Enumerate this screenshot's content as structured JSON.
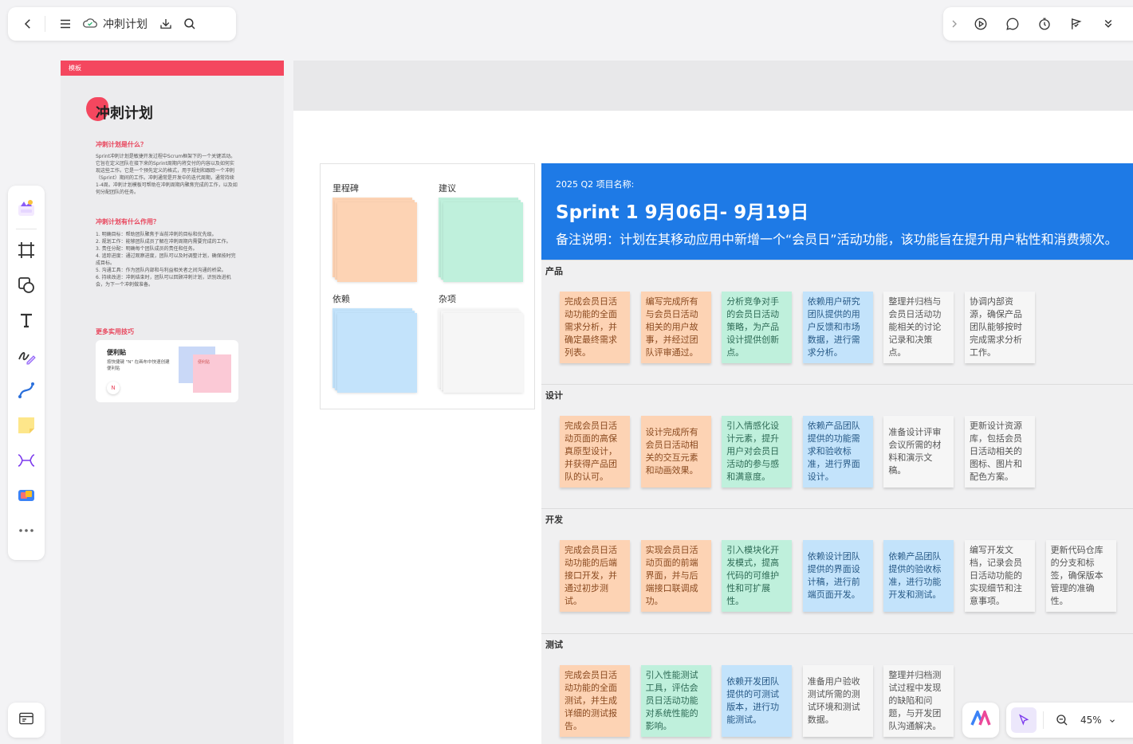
{
  "toolbar": {
    "doc_title": "冲刺计划"
  },
  "template": {
    "badge": "模板",
    "title": "冲刺计划",
    "h1": "冲刺计划是什么？",
    "p1": "Sprint冲刺计划是敏捷开发过程中Scrum框架下的一个关键活动。它旨在定义团队在接下来的Sprint周期内将交付的内容以及如何实现这些工作。它是一个预先定义的格式，用于规划和跟踪一个冲刺（Sprint）期间的工作。冲刺通常是开发中的迭代周期，通常持续1-4周。冲刺计划模板可帮助在冲刺周期内聚焦完成的工作，以及如何分配团队的任务。",
    "h2": "冲刺计划有什么作用？",
    "list": [
      "1. 明确目标：帮助团队聚焦于当前冲刺的目标和优先级。",
      "2. 规划工作：能够团队成员了解在冲刺周期内需要完成的工作。",
      "3. 责任分配：明确每个团队成员的责任和任务。",
      "4. 追踪进度：通过观察进度，团队可以及时调整计划，确保按时完成目标。",
      "5. 沟通工具：作为团队内部和与利益相关者之间沟通的桥梁。",
      "6. 持续改进：冲刺结束时，团队可以回顾冲刺计划，识别改进机会，为下一个冲刺做准备。"
    ],
    "h3": "更多实用技巧",
    "card_title": "便利贴",
    "card_desc": "按快捷键 \"N\" 在画布中快速创建便利贴",
    "card_key": "N",
    "card_sticky": "便利贴"
  },
  "legend": {
    "milestone": "里程碑",
    "suggestion": "建议",
    "dependency": "依赖",
    "misc": "杂项"
  },
  "sprint": {
    "project_label": "2025 Q2 项目名称:",
    "title": "Sprint 1   9月06日- 9月19日",
    "note": "备注说明：计划在其移动应用中新增一个“会员日”活动功能，该功能旨在提升用户粘性和消费频次。"
  },
  "lanes": [
    {
      "name": "产品",
      "notes": [
        {
          "text": "完成会员日活动功能的全面需求分析，并确定最终需求列表。",
          "color": "orange"
        },
        {
          "text": "编写完成所有与会员日活动相关的用户故事，并经过团队评审通过。",
          "color": "orange"
        },
        {
          "text": "分析竞争对手的会员日活动策略，为产品设计提供创新点。",
          "color": "green"
        },
        {
          "text": "依赖用户研究团队提供的用户反馈和市场数据，进行需求分析。",
          "color": "blue"
        },
        {
          "text": "整理并归档与会员日活动功能相关的讨论记录和决策点。",
          "color": "white"
        },
        {
          "text": "协调内部资源，确保产品团队能够按时完成需求分析工作。",
          "color": "white"
        }
      ]
    },
    {
      "name": "设计",
      "notes": [
        {
          "text": "完成会员日活动页面的高保真原型设计，并获得产品团队的认可。",
          "color": "orange"
        },
        {
          "text": "设计完成所有会员日活动相关的交互元素和动画效果。",
          "color": "orange"
        },
        {
          "text": "引入情感化设计元素，提升用户对会员日活动的参与感和满意度。",
          "color": "green"
        },
        {
          "text": "依赖产品团队提供的功能需求和验收标准，进行界面设计。",
          "color": "blue"
        },
        {
          "text": "准备设计评审会议所需的材料和演示文稿。",
          "color": "white"
        },
        {
          "text": "更新设计资源库，包括会员日活动相关的图标、图片和配色方案。",
          "color": "white"
        }
      ]
    },
    {
      "name": "开发",
      "notes": [
        {
          "text": "完成会员日活动功能的后端接口开发，并通过初步测试。",
          "color": "orange"
        },
        {
          "text": "实现会员日活动页面的前端界面，并与后端接口联调成功。",
          "color": "orange"
        },
        {
          "text": "引入模块化开发模式，提高代码的可维护性和可扩展性。",
          "color": "green"
        },
        {
          "text": "依赖设计团队提供的界面设计稿，进行前端页面开发。",
          "color": "blue"
        },
        {
          "text": "依赖产品团队提供的验收标准，进行功能开发和测试。",
          "color": "blue"
        },
        {
          "text": "编写开发文档，记录会员日活动功能的实现细节和注意事项。",
          "color": "white"
        },
        {
          "text": "更新代码仓库的分支和标签，确保版本管理的准确性。",
          "color": "white"
        }
      ]
    },
    {
      "name": "测试",
      "notes": [
        {
          "text": "完成会员日活动功能的全面测试，并生成详细的测试报告。",
          "color": "orange"
        },
        {
          "text": "引入性能测试工具，评估会员日活动功能对系统性能的影响。",
          "color": "green"
        },
        {
          "text": "依赖开发团队提供的可测试版本，进行功能测试。",
          "color": "blue"
        },
        {
          "text": "准备用户验收测试所需的测试环境和测试数据。",
          "color": "white"
        },
        {
          "text": "整理并归档测试过程中发现的缺陷和问题，与开发团队沟通解决。",
          "color": "white"
        }
      ]
    }
  ],
  "zoom": {
    "value": "45%"
  },
  "colors": {
    "accent": "#1e7ae6",
    "brand_red": "#f4475f",
    "orange": "#fdd3b4",
    "green": "#bff0dc",
    "blue": "#c3e3fb",
    "white": "#f6f6f6"
  }
}
